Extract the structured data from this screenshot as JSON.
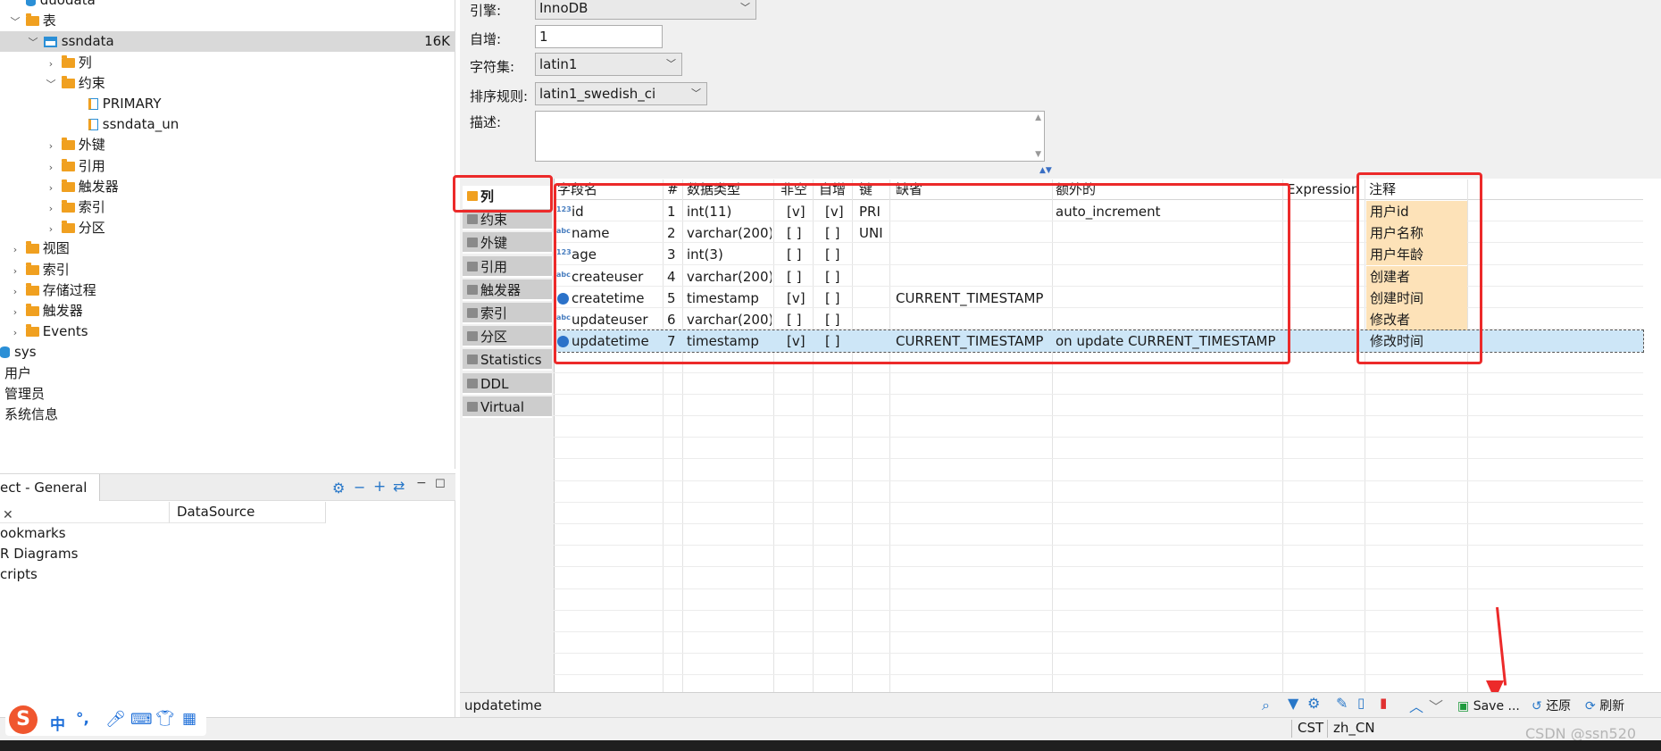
{
  "tree": [
    {
      "label": "duodata",
      "indent": 10,
      "arrow": "v",
      "icon": "db"
    },
    {
      "label": "表",
      "indent": 10,
      "arrow": "v",
      "icon": "folder"
    },
    {
      "label": "ssndata",
      "indent": 30,
      "arrow": "v",
      "icon": "table",
      "size": "16K",
      "selected": true
    },
    {
      "label": "列",
      "indent": 50,
      "arrow": ">",
      "icon": "folder"
    },
    {
      "label": "约束",
      "indent": 50,
      "arrow": "v",
      "icon": "folder"
    },
    {
      "label": "PRIMARY",
      "indent": 80,
      "arrow": "",
      "icon": "key"
    },
    {
      "label": "ssndata_un",
      "indent": 80,
      "arrow": "",
      "icon": "key"
    },
    {
      "label": "外键",
      "indent": 50,
      "arrow": ">",
      "icon": "folder"
    },
    {
      "label": "引用",
      "indent": 50,
      "arrow": ">",
      "icon": "folder"
    },
    {
      "label": "触发器",
      "indent": 50,
      "arrow": ">",
      "icon": "folder"
    },
    {
      "label": "索引",
      "indent": 50,
      "arrow": ">",
      "icon": "folder"
    },
    {
      "label": "分区",
      "indent": 50,
      "arrow": ">",
      "icon": "folder"
    },
    {
      "label": "视图",
      "indent": 10,
      "arrow": ">",
      "icon": "folder"
    },
    {
      "label": "索引",
      "indent": 10,
      "arrow": ">",
      "icon": "folder"
    },
    {
      "label": "存储过程",
      "indent": 10,
      "arrow": ">",
      "icon": "folder"
    },
    {
      "label": "触发器",
      "indent": 10,
      "arrow": ">",
      "icon": "folder"
    },
    {
      "label": "Events",
      "indent": 10,
      "arrow": ">",
      "icon": "folder"
    },
    {
      "label": "sys",
      "indent": 0,
      "arrow": "",
      "icon": "db"
    },
    {
      "label": "用户",
      "indent": -8,
      "arrow": "",
      "icon": "dot"
    },
    {
      "label": "管理员",
      "indent": -8,
      "arrow": "",
      "icon": "dot"
    },
    {
      "label": "系统信息",
      "indent": -8,
      "arrow": "",
      "icon": "dot"
    }
  ],
  "project_panel": {
    "tab_title": "ect - General",
    "column_header": "DataSource",
    "items": [
      "ookmarks",
      "R Diagrams",
      "cripts"
    ]
  },
  "properties": {
    "engine_label": "引擎:",
    "engine_value": "InnoDB",
    "autoinc_label": "自增:",
    "autoinc_value": "1",
    "charset_label": "字符集:",
    "charset_value": "latin1",
    "collation_label": "排序规则:",
    "collation_value": "latin1_swedish_ci",
    "desc_label": "描述:"
  },
  "side_tabs": [
    "列",
    "约束",
    "外键",
    "引用",
    "触发器",
    "索引",
    "分区",
    "Statistics",
    "DDL",
    "Virtual"
  ],
  "columns_header": {
    "name": "字段名",
    "num": "#",
    "type": "数据类型",
    "notnull": "非空",
    "autoinc": "自增",
    "key": "键",
    "default": "缺省",
    "extra": "额外的",
    "expr": "Expression",
    "comment": "注释"
  },
  "rows": [
    {
      "name": "id",
      "num": "1",
      "type": "int(11)",
      "notnull": "[v]",
      "autoinc": "[v]",
      "key": "PRI",
      "default": "",
      "extra": "auto_increment",
      "comment": "用户id",
      "icon": "123"
    },
    {
      "name": "name",
      "num": "2",
      "type": "varchar(200)",
      "notnull": "[ ]",
      "autoinc": "[ ]",
      "key": "UNI",
      "default": "",
      "extra": "",
      "comment": "用户名称",
      "icon": "abc"
    },
    {
      "name": "age",
      "num": "3",
      "type": "int(3)",
      "notnull": "[ ]",
      "autoinc": "[ ]",
      "key": "",
      "default": "",
      "extra": "",
      "comment": "用户年龄",
      "icon": "123"
    },
    {
      "name": "createuser",
      "num": "4",
      "type": "varchar(200)",
      "notnull": "[ ]",
      "autoinc": "[ ]",
      "key": "",
      "default": "",
      "extra": "",
      "comment": "创建者",
      "icon": "abc"
    },
    {
      "name": "createtime",
      "num": "5",
      "type": "timestamp",
      "notnull": "[v]",
      "autoinc": "[ ]",
      "key": "",
      "default": "CURRENT_TIMESTAMP",
      "extra": "",
      "comment": "创建时间",
      "icon": "clock"
    },
    {
      "name": "updateuser",
      "num": "6",
      "type": "varchar(200)",
      "notnull": "[ ]",
      "autoinc": "[ ]",
      "key": "",
      "default": "",
      "extra": "",
      "comment": "修改者",
      "icon": "abc"
    },
    {
      "name": "updatetime",
      "num": "7",
      "type": "timestamp",
      "notnull": "[v]",
      "autoinc": "[ ]",
      "key": "",
      "default": "CURRENT_TIMESTAMP",
      "extra": "on update CURRENT_TIMESTAMP",
      "comment": "修改时间",
      "icon": "clock",
      "selected": true
    }
  ],
  "bottom_bar": {
    "selected_name": "updatetime",
    "save_label": "Save ...",
    "revert_label": "还原",
    "refresh_label": "刷新"
  },
  "status_bar": {
    "tz": "CST",
    "locale": "zh_CN"
  },
  "ime_bar": {
    "mode": "中",
    "punct": "°,"
  },
  "watermark": "CSDN @ssn520",
  "colors": {
    "selection": "#cde6f7",
    "comment_bg": "#fde2b8",
    "annotation_red": "#ec2a2a",
    "folder": "#f0a020"
  }
}
